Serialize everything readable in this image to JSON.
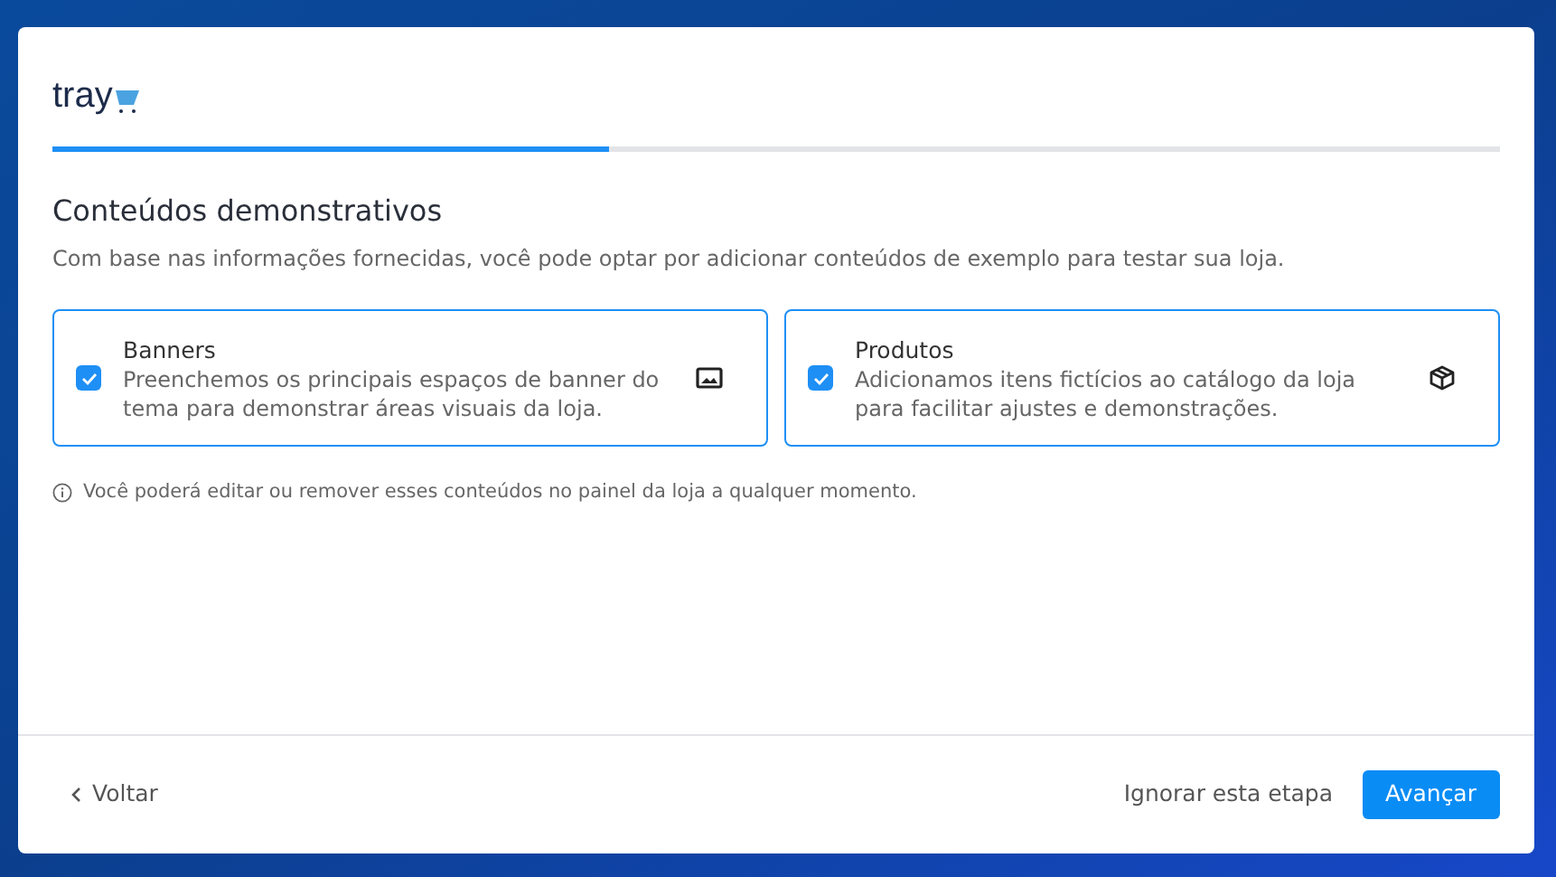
{
  "logo": {
    "text": "tray"
  },
  "progress": {
    "level": 0.385
  },
  "title": "Conteúdos demonstrativos",
  "description": "Com base nas informações fornecidas, você pode optar por adicionar conteúdos de exemplo para testar sua loja.",
  "options": [
    {
      "title": "Banners",
      "description": "Preenchemos os principais espaços de banner do tema para demonstrar áreas visuais da loja.",
      "checked": true,
      "kind": "image"
    },
    {
      "title": "Produtos",
      "description": "Adicionamos itens fictícios ao catálogo da loja para facilitar ajustes e demonstrações.",
      "checked": true,
      "kind": "box"
    }
  ],
  "note": "Você poderá editar ou remover esses conteúdos no painel da loja a qualquer momento.",
  "footer": {
    "back": "Voltar",
    "skip": "Ignorar esta etapa",
    "next": "Avançar"
  }
}
